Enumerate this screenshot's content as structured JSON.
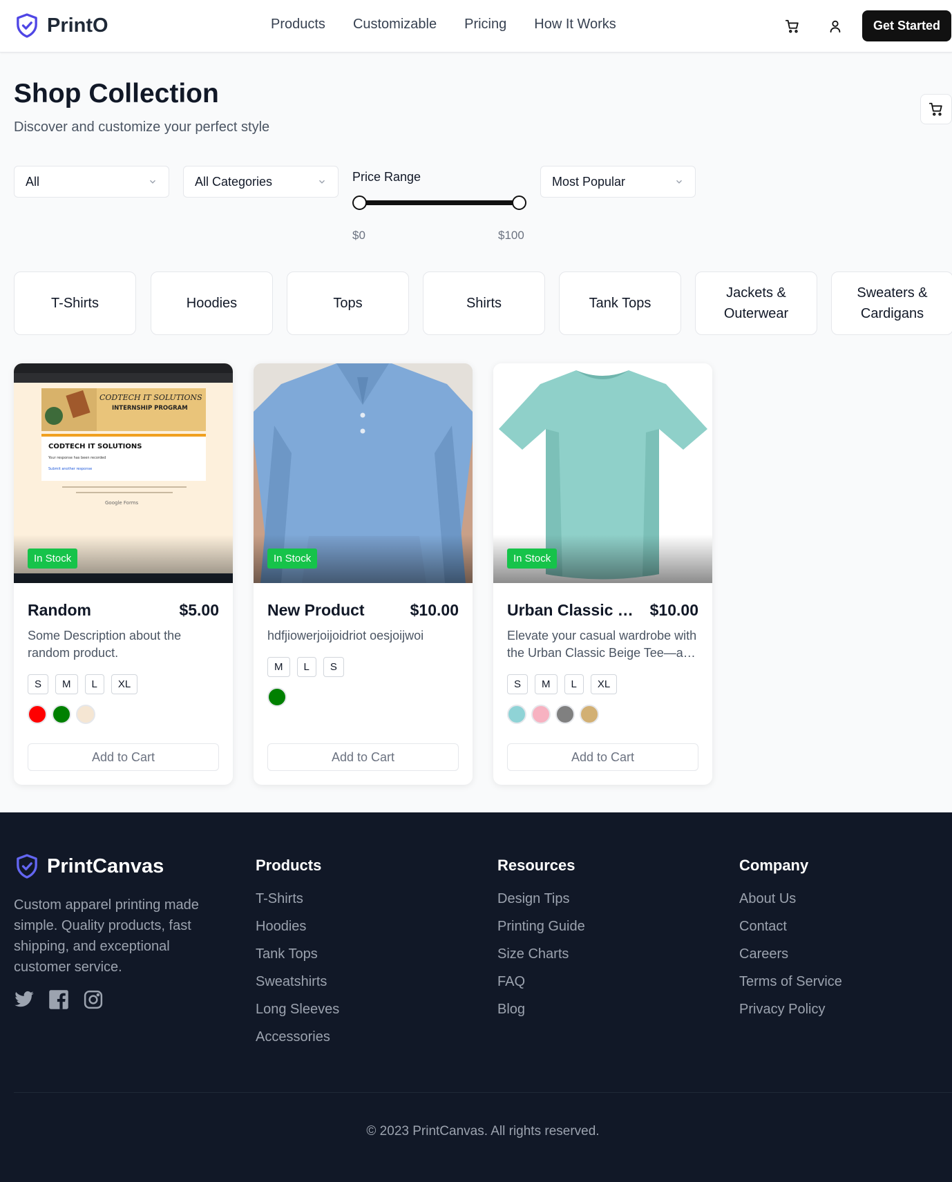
{
  "header": {
    "brand": "PrintO",
    "nav": [
      "Products",
      "Customizable",
      "Pricing",
      "How It Works"
    ],
    "cta": "Get Started",
    "icons": [
      "cart-icon",
      "user-icon",
      "shield-check-icon"
    ]
  },
  "main": {
    "title": "Shop Collection",
    "subtitle": "Discover and customize your perfect style"
  },
  "filters": {
    "type": "All",
    "category": "All Categories",
    "price_label": "Price Range",
    "price_min": "$0",
    "price_max": "$100",
    "sort": "Most Popular"
  },
  "categories": [
    "T-Shirts",
    "Hoodies",
    "Tops",
    "Shirts",
    "Tank Tops",
    "Jackets & Outerwear",
    "Sweaters & Cardigans"
  ],
  "products": [
    {
      "badge": "In Stock",
      "name": "Random",
      "price": "$5.00",
      "description": "Some Description about the random product.",
      "sizes": [
        "S",
        "M",
        "L",
        "XL"
      ],
      "colors": [
        "#ff0000",
        "#008000",
        "#f5e6d3"
      ],
      "add_label": "Add to Cart",
      "image_text": {
        "banner": "CODTECH IT SOLUTIONS",
        "program": "INTERNSHIP PROGRAM",
        "form_title": "CODTECH IT SOLUTIONS",
        "form_msg": "Your response has been recorded",
        "form_link": "Submit another response",
        "forms_brand": "Google Forms"
      }
    },
    {
      "badge": "In Stock",
      "name": "New Product",
      "price": "$10.00",
      "description": "hdfjiowerjoijoidriot oesjoijwoi",
      "sizes": [
        "M",
        "L",
        "S"
      ],
      "colors": [
        "#008000"
      ],
      "add_label": "Add to Cart"
    },
    {
      "badge": "In Stock",
      "name": "Urban Classic Beige Tee",
      "price": "$10.00",
      "description": "Elevate your casual wardrobe with the Urban Classic Beige Tee—a…",
      "sizes": [
        "S",
        "M",
        "L",
        "XL"
      ],
      "colors": [
        "#8fd3d6",
        "#f7b2c1",
        "#808080",
        "#d2b074"
      ],
      "add_label": "Add to Cart"
    }
  ],
  "footer": {
    "brand": "PrintCanvas",
    "about": "Custom apparel printing made simple. Quality products, fast shipping, and exceptional customer service.",
    "social_icons": [
      "twitter-icon",
      "facebook-icon",
      "instagram-icon"
    ],
    "columns": [
      {
        "title": "Products",
        "links": [
          "T-Shirts",
          "Hoodies",
          "Tank Tops",
          "Sweatshirts",
          "Long Sleeves",
          "Accessories"
        ]
      },
      {
        "title": "Resources",
        "links": [
          "Design Tips",
          "Printing Guide",
          "Size Charts",
          "FAQ",
          "Blog"
        ]
      },
      {
        "title": "Company",
        "links": [
          "About Us",
          "Contact",
          "Careers",
          "Terms of Service",
          "Privacy Policy"
        ]
      }
    ],
    "copyright": "© 2023 PrintCanvas. All rights reserved."
  },
  "colors": {
    "brand": "#4f46e5",
    "in_stock": "#16c34a",
    "footer_bg": "#111827"
  }
}
